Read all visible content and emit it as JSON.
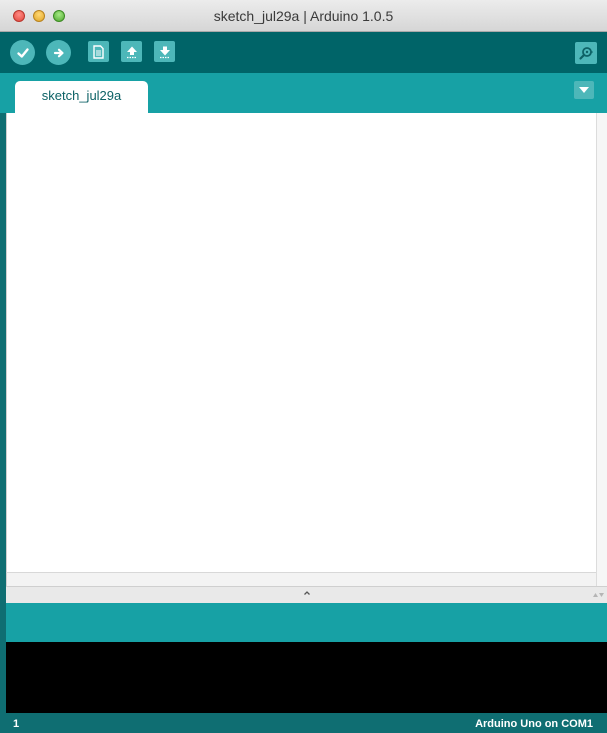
{
  "window": {
    "title": "sketch_jul29a | Arduino 1.0.5"
  },
  "toolbar": {
    "buttons": [
      {
        "name": "verify",
        "icon": "checkmark-icon"
      },
      {
        "name": "upload",
        "icon": "arrow-right-icon"
      },
      {
        "name": "new",
        "icon": "document-icon"
      },
      {
        "name": "open",
        "icon": "arrow-up-icon"
      },
      {
        "name": "save",
        "icon": "arrow-down-icon"
      },
      {
        "name": "serial-monitor",
        "icon": "magnifier-icon"
      }
    ]
  },
  "tabs": [
    {
      "label": "sketch_jul29a",
      "active": true
    }
  ],
  "editor": {
    "content": ""
  },
  "status": {
    "line_number": "1",
    "board": "Arduino Uno on COM1"
  },
  "colors": {
    "toolbar": "#006468",
    "tabbar": "#17a1a5",
    "button": "#4db7b9",
    "status": "#0f6e72",
    "console": "#000000"
  }
}
